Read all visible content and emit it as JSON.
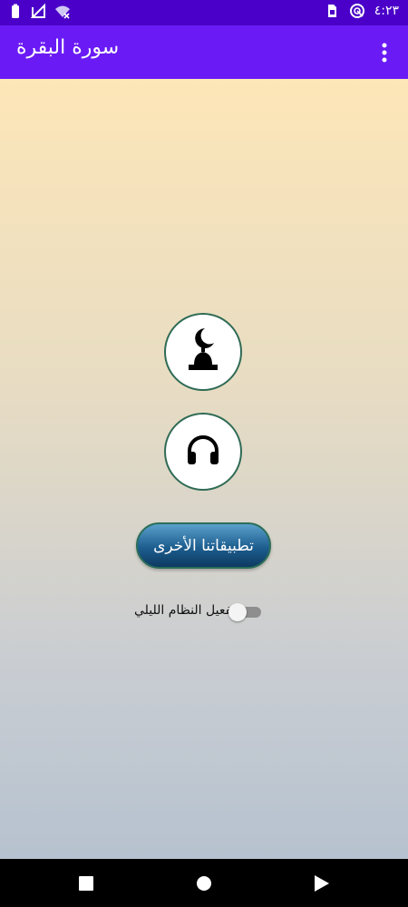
{
  "status_bar": {
    "time": "٤:٢٣",
    "icons": [
      "battery-icon",
      "signal-icon",
      "wifi-icon",
      "sim-card-icon",
      "data-saver-icon"
    ]
  },
  "app_bar": {
    "title": "سورة البقرة",
    "menu_icon": "more-vert-icon"
  },
  "main": {
    "mosque_button_icon": "mosque-icon",
    "audio_button_icon": "headphones-icon",
    "other_apps_label": "تطبيقاتنا الأخرى",
    "night_mode_label": "تفعيل النظام الليلي",
    "night_mode_enabled": false
  },
  "nav_bar": {
    "icons": [
      "recents-icon",
      "home-icon",
      "back-icon"
    ]
  },
  "colors": {
    "status_bar": "#4a00c8",
    "app_bar": "#6a1bf5",
    "button_border": "#2f6b55",
    "gradient_top": "#fde6b8",
    "gradient_bottom": "#b6c2cf"
  }
}
